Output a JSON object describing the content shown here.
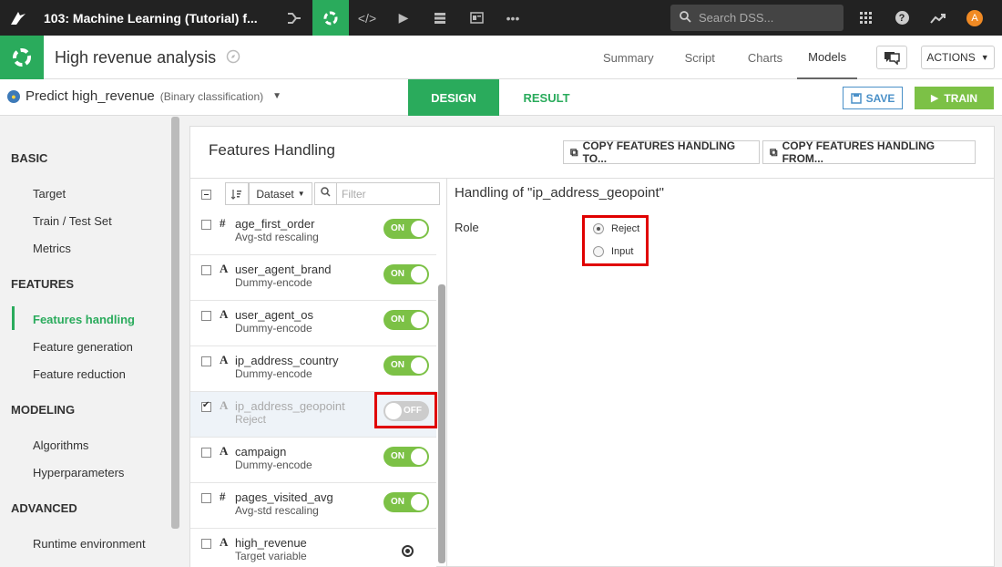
{
  "topbar": {
    "project_title": "103: Machine Learning (Tutorial) f...",
    "search_placeholder": "Search DSS...",
    "avatar_letter": "A"
  },
  "header": {
    "analysis_title": "High revenue analysis",
    "tabs": [
      "Summary",
      "Script",
      "Charts",
      "Models"
    ],
    "active_tab": "Models",
    "actions_label": "ACTIONS"
  },
  "subheader": {
    "model_name": "Predict high_revenue",
    "model_kind": "(Binary classification)",
    "design_label": "DESIGN",
    "result_label": "RESULT",
    "save_label": "SAVE",
    "train_label": "TRAIN"
  },
  "sidebar": {
    "sections": [
      {
        "title": "BASIC",
        "items": [
          "Target",
          "Train / Test Set",
          "Metrics"
        ]
      },
      {
        "title": "FEATURES",
        "items": [
          "Features handling",
          "Feature generation",
          "Feature reduction"
        ]
      },
      {
        "title": "MODELING",
        "items": [
          "Algorithms",
          "Hyperparameters"
        ]
      },
      {
        "title": "ADVANCED",
        "items": [
          "Runtime environment"
        ]
      }
    ],
    "active_item": "Features handling"
  },
  "panel": {
    "title": "Features Handling",
    "copy_to_label": "COPY FEATURES HANDLING TO...",
    "copy_from_label": "COPY FEATURES HANDLING FROM...",
    "sort_select": "Dataset",
    "filter_placeholder": "Filter"
  },
  "features": [
    {
      "type_icon": "#",
      "name": "age_first_order",
      "handling": "Avg-std rescaling",
      "toggle": "ON",
      "checked": false
    },
    {
      "type_icon": "A",
      "name": "user_agent_brand",
      "handling": "Dummy-encode",
      "toggle": "ON",
      "checked": false
    },
    {
      "type_icon": "A",
      "name": "user_agent_os",
      "handling": "Dummy-encode",
      "toggle": "ON",
      "checked": false
    },
    {
      "type_icon": "A",
      "name": "ip_address_country",
      "handling": "Dummy-encode",
      "toggle": "ON",
      "checked": false
    },
    {
      "type_icon": "A",
      "name": "ip_address_geopoint",
      "handling": "Reject",
      "toggle": "OFF",
      "checked": true
    },
    {
      "type_icon": "A",
      "name": "campaign",
      "handling": "Dummy-encode",
      "toggle": "ON",
      "checked": false
    },
    {
      "type_icon": "#",
      "name": "pages_visited_avg",
      "handling": "Avg-std rescaling",
      "toggle": "ON",
      "checked": false
    },
    {
      "type_icon": "A",
      "name": "high_revenue",
      "handling": "Target variable",
      "toggle": "target",
      "checked": false
    }
  ],
  "detail": {
    "title": "Handling of \"ip_address_geopoint\"",
    "role_label": "Role",
    "role_options": [
      "Reject",
      "Input"
    ],
    "role_selected": "Reject"
  },
  "colors": {
    "accent_green": "#2aab5c",
    "toggle_green": "#7cc146",
    "highlight_red": "#e00000"
  }
}
